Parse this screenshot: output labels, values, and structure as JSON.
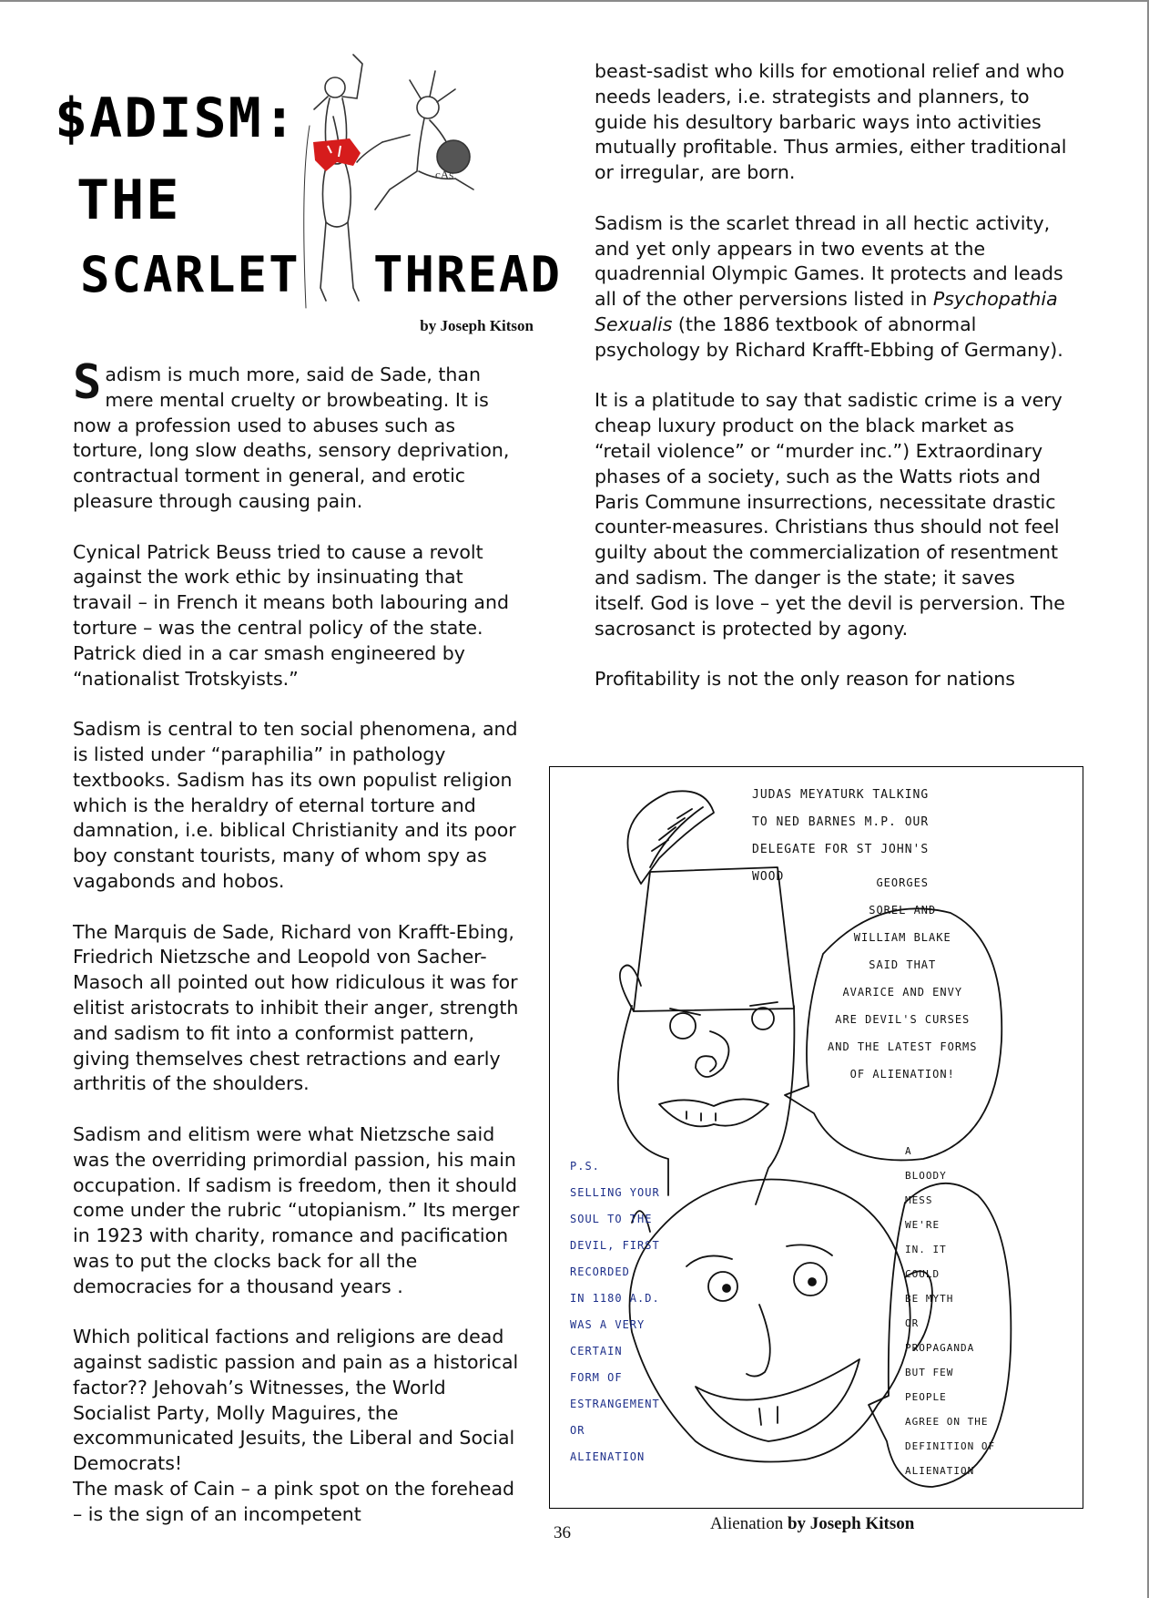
{
  "header": {
    "title_line1": "$ADISM:",
    "title_line2": "THE",
    "title_line3a": "SCARLET",
    "title_line3b": "THREAD",
    "art_initials": "cAs",
    "byline": "by Joseph Kitson"
  },
  "article": {
    "left_column": [
      {
        "dropcap": "S",
        "text": "adism is much more, said de Sade, than mere mental cruelty or browbeating.  It is now a profession used to abuses such as torture, long slow deaths, sensory deprivation, contractual torment in general, and erotic pleasure through causing pain."
      },
      {
        "text": "Cynical Patrick Beuss tried to cause a revolt against the work ethic by insinuating that travail – in French it means both labouring and torture – was the central policy of the state.  Patrick died in a car smash engineered by “nationalist Trotskyists.”"
      },
      {
        "text": "Sadism is central to ten social phenomena, and is listed under “paraphilia” in pathology textbooks.  Sadism has its own populist religion which is the heraldry of eternal torture and damnation, i.e. biblical Christianity and its poor boy constant tourists, many of whom spy as vagabonds and hobos."
      },
      {
        "text": "The Marquis de Sade, Richard von Krafft-Ebing, Friedrich Nietzsche and Leopold von Sacher-Masoch all pointed out how ridiculous it was for elitist aristocrats to inhibit their anger, strength and sadism to fit into a conformist pattern, giving themselves chest retractions and early arthritis of the shoulders."
      },
      {
        "text": "Sadism and elitism were what Nietzsche said was the overriding primordial passion, his main occupation.  If sadism is freedom, then it should come under the rubric “utopianism.”  Its merger in 1923 with charity, romance and pacification was to put the clocks back for all the democracies for a thousand years ."
      },
      {
        "text": "Which political factions and religions are dead against sadistic passion and pain as a historical factor??  Jehovah’s Witnesses, the World Socialist Party, Molly Maguires, the excommunicated Jesuits, the Liberal and Social Democrats!"
      },
      {
        "text": "The mask of Cain – a pink spot on the forehead – is the sign of an incompetent"
      }
    ],
    "right_column": {
      "p1": "beast-sadist who kills for emotional relief and who needs leaders, i.e. strategists and planners, to guide his desultory barbaric ways into activities mutually profitable. Thus armies, either traditional or irregular, are born.",
      "p2_before": "Sadism is the scarlet thread in all hectic activity, and yet only appears in two events at the quadrennial Olympic Games.  It protects and leads all of the other perversions listed in ",
      "p2_italic": "Psychopathia Sexualis",
      "p2_after": " (the 1886 textbook of abnormal psychology by Richard Krafft-Ebbing of Germany).",
      "p3": "It is a platitude to say that sadistic crime is a very cheap luxury product on the black market as “retail violence” or “murder inc.”)  Extraordinary phases of a society, such as the Watts riots and Paris Commune insurrections, necessitate drastic counter-measures. Christians thus should not feel guilty about the commercialization of resentment and sadism.  The danger is the state; it saves itself.  God is love – yet the devil is perversion. The sacrosanct is protected by agony.",
      "p4": "Profitability is not the only reason for nations"
    }
  },
  "cartoon": {
    "note_top": "JUDAS MEYATURK TALKING\nTO NED BARNES M.P. OUR\nDELEGATE FOR ST JOHN'S\nWOOD",
    "bubble_1": "GEORGES\nSOREL AND\nWILLIAM BLAKE\nSAID THAT\nAVARICE AND ENVY\nARE DEVIL'S CURSES\nAND THE LATEST FORMS\nOF ALIENATION!",
    "note_ps": "P.S.\nSELLING YOUR\nSOUL TO THE\nDEVIL, FIRST\nRECORDED\nIN 1180 A.D.\nWAS A VERY\nCERTAIN\nFORM OF\nESTRANGEMENT\nOR\nALIENATION",
    "bubble_2": "A\nBLOODY\nMESS\nWE'RE\nIN. IT\nCOULD\nBE MYTH\nOR\nPROPAGANDA\nBUT FEW\nPEOPLE\nAGREE ON THE\nDEFINITION OF\nALIENATION"
  },
  "footer": {
    "page_number": "36",
    "caption_title": "Alienation",
    "caption_by": " by Joseph Kitson"
  },
  "colors": {
    "text": "#111111",
    "accent_red": "#d61c1c",
    "ink_blue": "#1d2f8a"
  }
}
